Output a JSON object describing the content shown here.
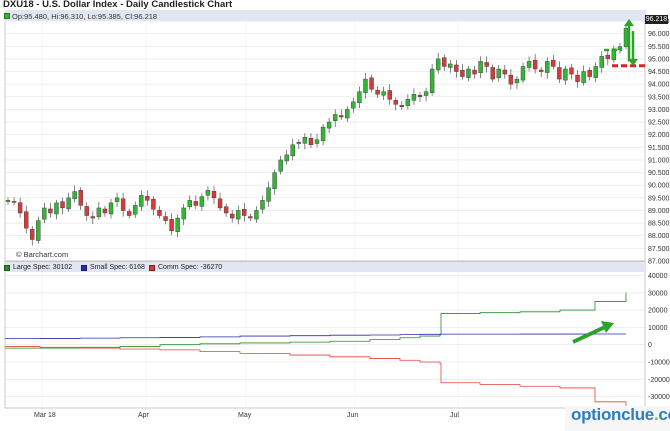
{
  "title": "DXU18 - U.S. Dollar Index - Daily Candlestick Chart",
  "ohlc": "Op:95.480, Hi:96.310, Lo:95.385, Cl:96.218",
  "credit": "© Barchart.com",
  "last_price_tag": "96.218",
  "watermark": {
    "main": "optionclue",
    "dot": ".",
    "tld": "com"
  },
  "colors": {
    "up": "#35b535",
    "down": "#d63a3a",
    "large": "#2a8a2a",
    "small": "#2b2bb0",
    "comm": "#e0443a",
    "arrow": "#2aa52a",
    "dash": "#e02020"
  },
  "chart_data": [
    {
      "type": "candlestick",
      "title": "DXU18 - U.S. Dollar Index - Daily Candlestick Chart",
      "y_ticks": [
        "87.000",
        "87.500",
        "88.000",
        "88.500",
        "89.000",
        "89.500",
        "90.000",
        "90.500",
        "91.000",
        "91.500",
        "92.000",
        "92.500",
        "93.000",
        "93.500",
        "94.000",
        "94.500",
        "95.000",
        "95.500",
        "96.000",
        "96.500"
      ],
      "ylim": [
        87.0,
        96.5
      ],
      "x_ticks": [
        "Mar 18",
        "Apr",
        "May",
        "Jun",
        "Jul"
      ],
      "last": {
        "open": 95.48,
        "high": 96.31,
        "low": 95.385,
        "close": 96.218
      },
      "series": [
        {
          "c": 89.4
        },
        {
          "c": 89.35
        },
        {
          "c": 88.9
        },
        {
          "c": 88.3
        },
        {
          "c": 87.85
        },
        {
          "c": 88.6
        },
        {
          "c": 89.1
        },
        {
          "c": 88.9
        },
        {
          "c": 89.3
        },
        {
          "c": 89.1
        },
        {
          "c": 89.5
        },
        {
          "c": 89.75
        },
        {
          "c": 89.2
        },
        {
          "c": 88.8
        },
        {
          "c": 88.7
        },
        {
          "c": 89.1
        },
        {
          "c": 88.9
        },
        {
          "c": 89.3
        },
        {
          "c": 89.5
        },
        {
          "c": 89.0
        },
        {
          "c": 88.8
        },
        {
          "c": 89.2
        },
        {
          "c": 89.6
        },
        {
          "c": 89.4
        },
        {
          "c": 89.05
        },
        {
          "c": 88.8
        },
        {
          "c": 88.6
        },
        {
          "c": 88.2
        },
        {
          "c": 88.7
        },
        {
          "c": 89.1
        },
        {
          "c": 89.4
        },
        {
          "c": 89.2
        },
        {
          "c": 89.55
        },
        {
          "c": 89.8
        },
        {
          "c": 89.5
        },
        {
          "c": 89.1
        },
        {
          "c": 88.9
        },
        {
          "c": 88.7
        },
        {
          "c": 89.0
        },
        {
          "c": 88.8
        },
        {
          "c": 88.7
        },
        {
          "c": 89.0
        },
        {
          "c": 89.4
        },
        {
          "c": 89.9
        },
        {
          "c": 90.5
        },
        {
          "c": 91.0
        },
        {
          "c": 91.2
        },
        {
          "c": 91.6
        },
        {
          "c": 91.7
        },
        {
          "c": 91.9
        },
        {
          "c": 91.6
        },
        {
          "c": 91.8
        },
        {
          "c": 92.3
        },
        {
          "c": 92.5
        },
        {
          "c": 92.8
        },
        {
          "c": 92.7
        },
        {
          "c": 93.0
        },
        {
          "c": 93.3
        },
        {
          "c": 93.7
        },
        {
          "c": 94.2
        },
        {
          "c": 93.8
        },
        {
          "c": 93.6
        },
        {
          "c": 93.7
        },
        {
          "c": 93.4
        },
        {
          "c": 93.2
        },
        {
          "c": 93.1
        },
        {
          "c": 93.4
        },
        {
          "c": 93.6
        },
        {
          "c": 93.5
        },
        {
          "c": 93.7
        },
        {
          "c": 94.6
        },
        {
          "c": 95.0
        },
        {
          "c": 94.7
        },
        {
          "c": 94.8
        },
        {
          "c": 94.5
        },
        {
          "c": 94.3
        },
        {
          "c": 94.6
        },
        {
          "c": 94.4
        },
        {
          "c": 94.9
        },
        {
          "c": 94.7
        },
        {
          "c": 94.2
        },
        {
          "c": 94.6
        },
        {
          "c": 94.4
        },
        {
          "c": 94.0
        },
        {
          "c": 94.2
        },
        {
          "c": 94.7
        },
        {
          "c": 94.9
        },
        {
          "c": 94.6
        },
        {
          "c": 94.5
        },
        {
          "c": 94.9
        },
        {
          "c": 94.7
        },
        {
          "c": 94.2
        },
        {
          "c": 94.6
        },
        {
          "c": 94.4
        },
        {
          "c": 94.1
        },
        {
          "c": 94.5
        },
        {
          "c": 94.3
        },
        {
          "c": 94.7
        },
        {
          "c": 95.1
        },
        {
          "c": 95.0
        },
        {
          "c": 95.4
        },
        {
          "c": 95.48
        },
        {
          "c": 96.218
        }
      ]
    },
    {
      "type": "line",
      "title": "",
      "y_ticks": [
        "40000",
        "30000",
        "20000",
        "10000",
        "0",
        "-10000",
        "-20000",
        "-30000"
      ],
      "ylim": [
        -36000,
        42000
      ],
      "series": [
        {
          "name": "Large Spec: 30102",
          "key": "large",
          "values": [
            -2000,
            -2000,
            -1500,
            -1000,
            0,
            500,
            1000,
            1500,
            2000,
            3000,
            4000,
            5000,
            6000,
            18000,
            18500,
            19000,
            20000,
            25000,
            30102
          ]
        },
        {
          "name": "Small Spec: 6168",
          "key": "small",
          "values": [
            3500,
            3600,
            3800,
            4000,
            4200,
            4500,
            5000,
            5200,
            5500,
            5600,
            5800,
            6000,
            6000,
            6100,
            6100,
            6150,
            6150,
            6168,
            6168
          ]
        },
        {
          "name": "Comm Spec: -36270",
          "key": "comm",
          "values": [
            -1000,
            -1500,
            -2000,
            -2500,
            -3000,
            -4000,
            -5000,
            -6000,
            -7000,
            -8000,
            -9000,
            -10000,
            -11000,
            -22000,
            -23000,
            -24000,
            -25000,
            -33000,
            -36270
          ]
        }
      ]
    }
  ]
}
